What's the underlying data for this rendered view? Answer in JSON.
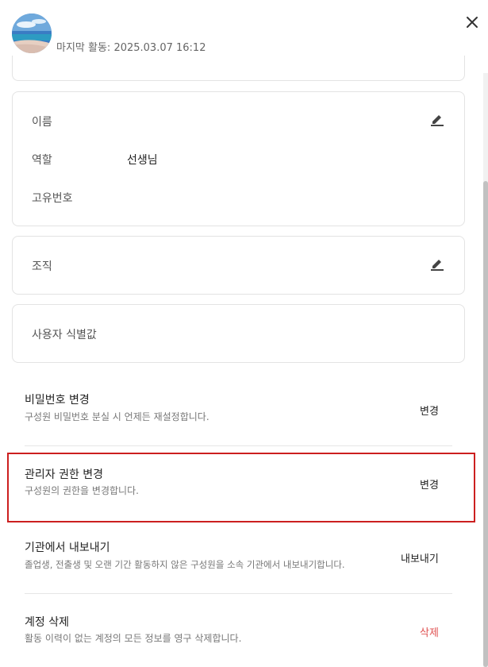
{
  "header": {
    "last_active": "마지막 활동: 2025.03.07 16:12"
  },
  "profile": {
    "name_label": "이름",
    "role_label": "역할",
    "role_value": "선생님",
    "unique_id_label": "고유번호"
  },
  "organization": {
    "label": "조직"
  },
  "user_identifier": {
    "label": "사용자 식별값"
  },
  "actions": [
    {
      "title": "비밀번호 변경",
      "desc": "구성원 비밀번호 분실 시 언제든 재설정합니다.",
      "action": "변경",
      "color": "#222222"
    },
    {
      "title": "관리자 권한 변경",
      "desc": "구성원의 권한을 변경합니다.",
      "action": "변경",
      "color": "#222222"
    },
    {
      "title": "기관에서 내보내기",
      "desc": "졸업생, 전출생 및 오랜 기간 활동하지 않은 구성원을 소속 기관에서 내보내기합니다.",
      "action": "내보내기",
      "color": "#222222"
    },
    {
      "title": "계정 삭제",
      "desc": "활동 이력이 없는 계정의 모든 정보를 영구 삭제합니다.",
      "action": "삭제",
      "color": "#e05252"
    }
  ],
  "colors": {
    "highlight": "#cc1f1f",
    "danger": "#e05252",
    "border": "#e3e3e3"
  }
}
